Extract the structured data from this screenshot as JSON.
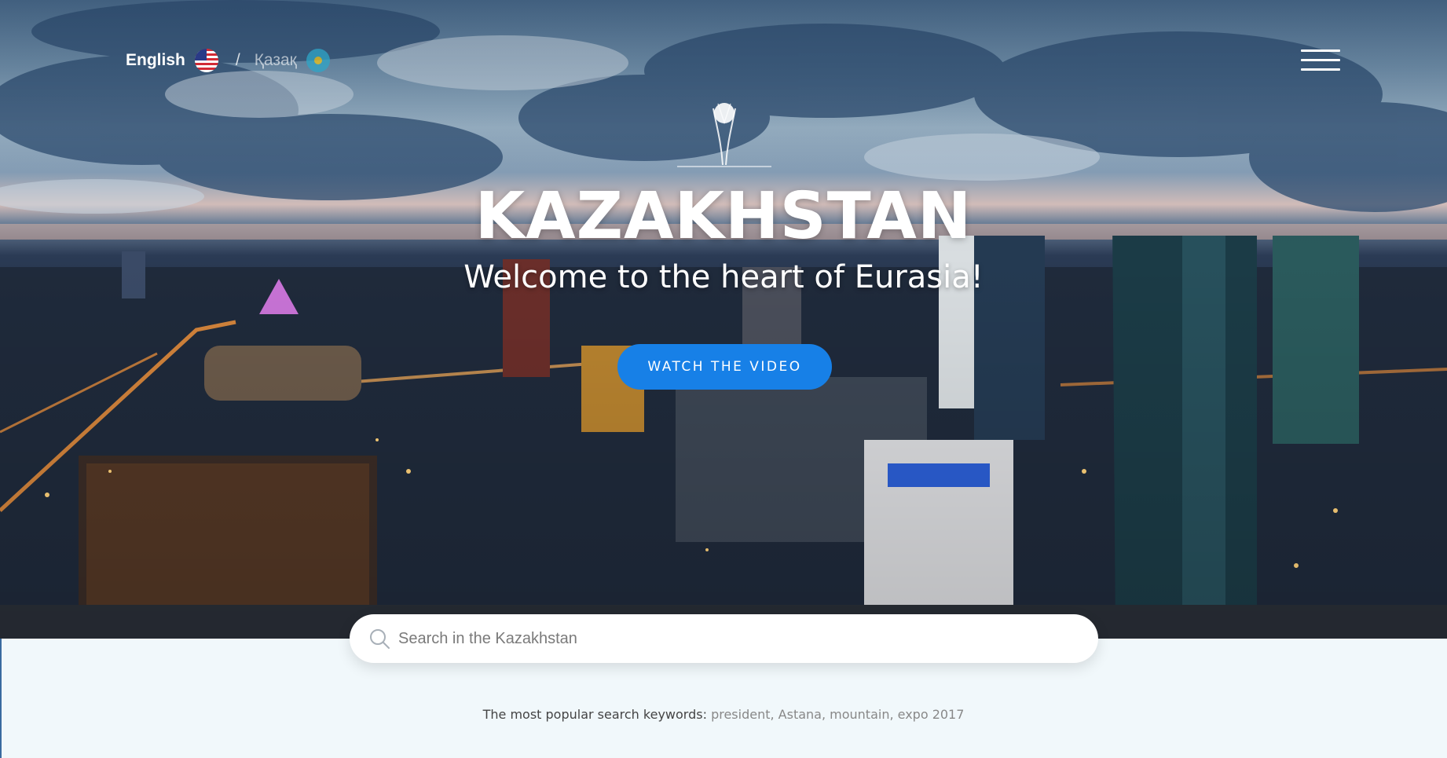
{
  "header": {
    "languages": [
      {
        "label": "English",
        "flag": "us-flag-icon",
        "active": true
      },
      {
        "label": "Қазақ",
        "flag": "kz-flag-icon",
        "active": false
      }
    ],
    "separator": "/",
    "menu_icon": "hamburger-icon"
  },
  "hero": {
    "logo_icon": "baiterek-tower-icon",
    "title": "KAZAKHSTAN",
    "subtitle": "Welcome to the heart of Eurasia!",
    "cta_label": "WATCH THE VIDEO"
  },
  "search": {
    "icon": "search-icon",
    "placeholder": "Search in the Kazakhstan",
    "value": ""
  },
  "popular": {
    "label": "The most popular search keywords:",
    "keywords": "president, Astana, mountain, expo 2017"
  },
  "colors": {
    "accent": "#1780e7",
    "page_background": "#f1f8fb"
  }
}
